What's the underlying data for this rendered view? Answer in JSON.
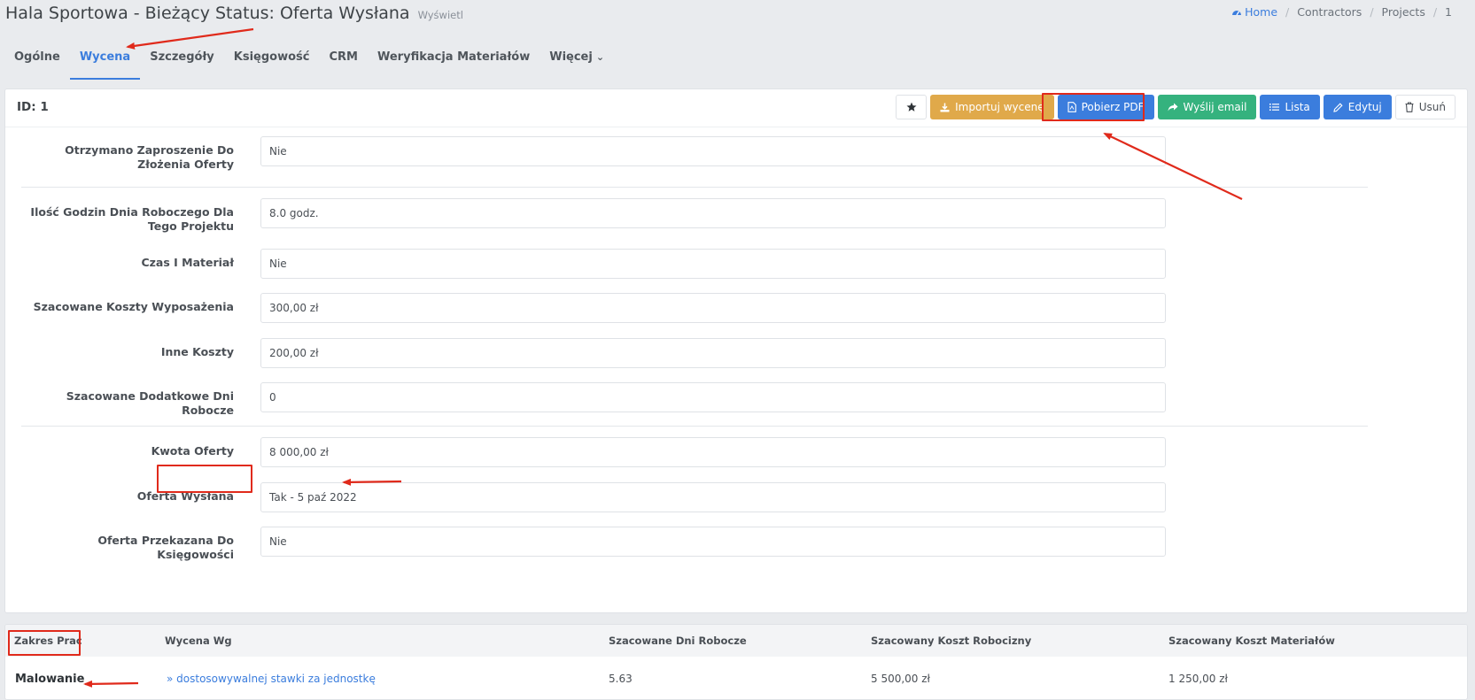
{
  "header": {
    "title": "Hala Sportowa - Bieżący Status: Oferta Wysłana",
    "subtitle": "Wyświetl"
  },
  "breadcrumb": {
    "home": "Home",
    "items": [
      "Contractors",
      "Projects",
      "1"
    ]
  },
  "tabs": [
    {
      "label": "Ogólne",
      "active": false
    },
    {
      "label": "Wycena",
      "active": true
    },
    {
      "label": "Szczegóły",
      "active": false
    },
    {
      "label": "Księgowość",
      "active": false
    },
    {
      "label": "CRM",
      "active": false
    },
    {
      "label": "Weryfikacja Materiałów",
      "active": false
    },
    {
      "label": "Więcej",
      "active": false
    }
  ],
  "card": {
    "id_label": "ID: 1"
  },
  "toolbar": {
    "import": "Importuj wycenę",
    "pdf": "Pobierz PDF",
    "email": "Wyślij email",
    "list": "Lista",
    "edit": "Edytuj",
    "delete": "Usuń"
  },
  "fields": [
    {
      "label": "Otrzymano Zaproszenie Do Złożenia Oferty",
      "value": "Nie"
    },
    {
      "label": "Ilość Godzin Dnia Roboczego Dla Tego Projektu",
      "value": "8.0 godz."
    },
    {
      "label": "Czas I Materiał",
      "value": "Nie"
    },
    {
      "label": "Szacowane Koszty Wyposażenia",
      "value": "300,00 zł"
    },
    {
      "label": "Inne Koszty",
      "value": "200,00 zł"
    },
    {
      "label": "Szacowane Dodatkowe Dni Robocze",
      "value": "0"
    },
    {
      "label": "Kwota Oferty",
      "value": "8 000,00 zł"
    },
    {
      "label": "Oferta Wysłana",
      "value": "Tak - 5 paź 2022"
    },
    {
      "label": "Oferta Przekazana Do Księgowości",
      "value": "Nie"
    }
  ],
  "table": {
    "columns": [
      "Zakres Prac",
      "Wycena Wg",
      "Szacowane Dni Robocze",
      "Szacowany Koszt Robocizny",
      "Szacowany Koszt Materiałów"
    ],
    "rows": [
      {
        "scope": "Malowanie",
        "pricing": "dostosowywalnej stawki za jednostkę",
        "days": "5.63",
        "labor": "5 500,00 zł",
        "materials": "1 250,00 zł"
      }
    ]
  },
  "colors": {
    "accent": "#3b7ddd",
    "warning": "#e0a94a",
    "success": "#35b27e",
    "annotation": "#e02a1b"
  }
}
